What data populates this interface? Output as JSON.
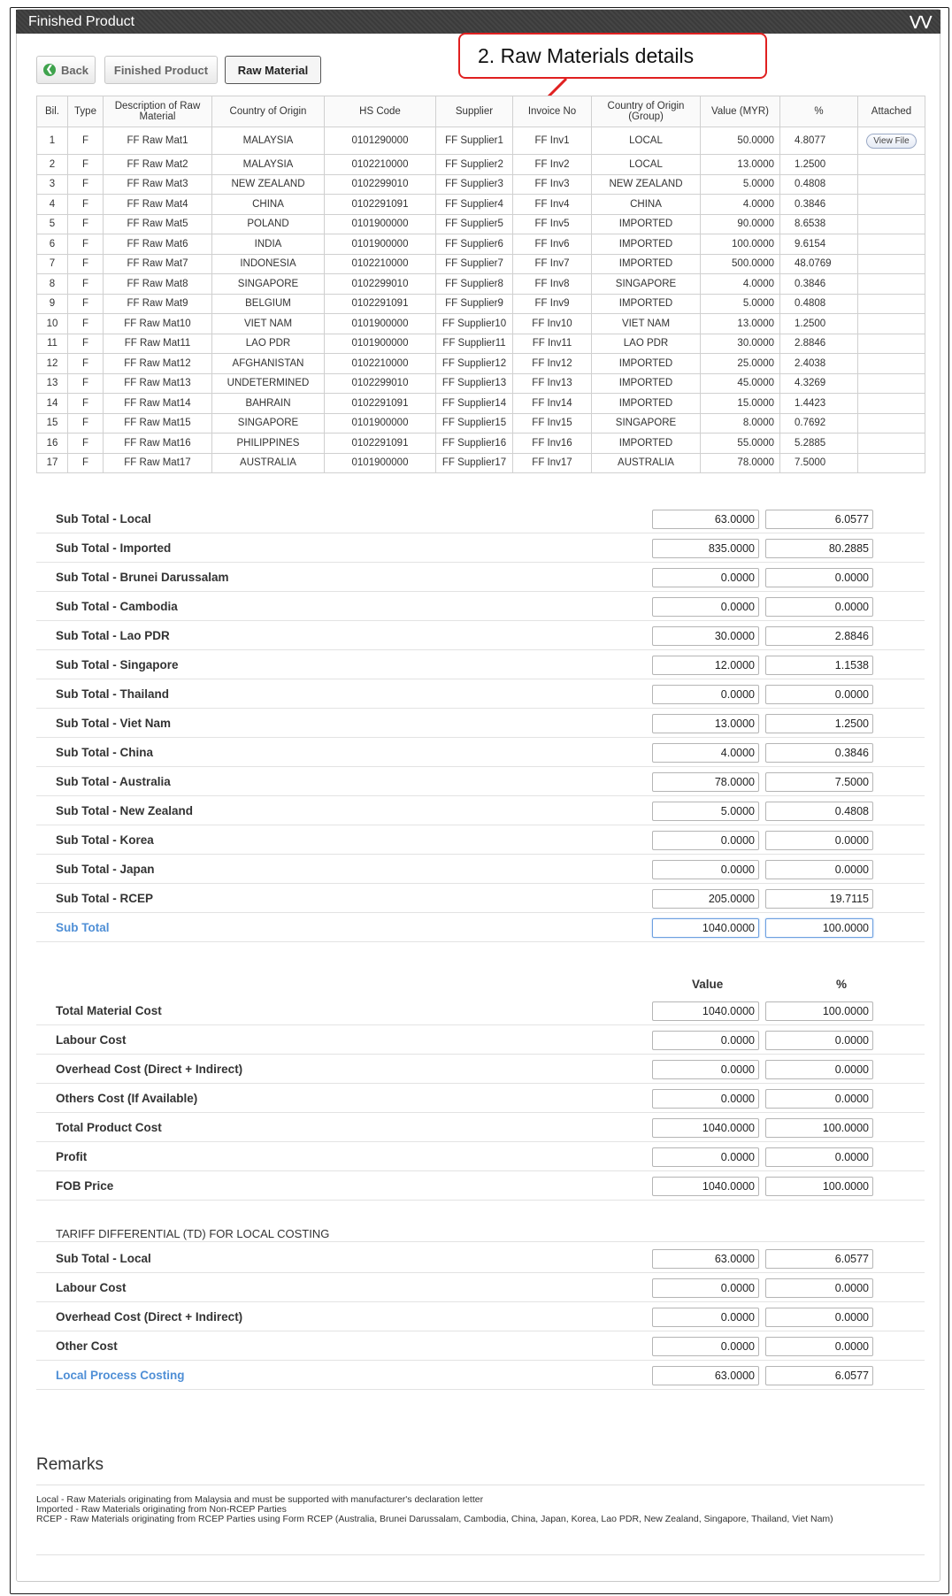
{
  "panel": {
    "title": "Finished Product"
  },
  "buttons": {
    "back": "Back",
    "finished_product": "Finished Product",
    "raw_material": "Raw Material"
  },
  "callout": {
    "text": "2. Raw Materials details"
  },
  "table": {
    "headers": [
      "Bil.",
      "Type",
      "Description of Raw Material",
      "Country of Origin",
      "HS Code",
      "Supplier",
      "Invoice No",
      "Country of Origin (Group)",
      "Value (MYR)",
      "%",
      "Attached"
    ],
    "view_file_label": "View File",
    "rows": [
      [
        "1",
        "F",
        "FF Raw Mat1",
        "MALAYSIA",
        "0101290000",
        "FF Supplier1",
        "FF Inv1",
        "LOCAL",
        "50.0000",
        "4.8077"
      ],
      [
        "2",
        "F",
        "FF Raw Mat2",
        "MALAYSIA",
        "0102210000",
        "FF Supplier2",
        "FF Inv2",
        "LOCAL",
        "13.0000",
        "1.2500"
      ],
      [
        "3",
        "F",
        "FF Raw Mat3",
        "NEW ZEALAND",
        "0102299010",
        "FF Supplier3",
        "FF Inv3",
        "NEW ZEALAND",
        "5.0000",
        "0.4808"
      ],
      [
        "4",
        "F",
        "FF Raw Mat4",
        "CHINA",
        "0102291091",
        "FF Supplier4",
        "FF Inv4",
        "CHINA",
        "4.0000",
        "0.3846"
      ],
      [
        "5",
        "F",
        "FF Raw Mat5",
        "POLAND",
        "0101900000",
        "FF Supplier5",
        "FF Inv5",
        "IMPORTED",
        "90.0000",
        "8.6538"
      ],
      [
        "6",
        "F",
        "FF Raw Mat6",
        "INDIA",
        "0101900000",
        "FF Supplier6",
        "FF Inv6",
        "IMPORTED",
        "100.0000",
        "9.6154"
      ],
      [
        "7",
        "F",
        "FF Raw Mat7",
        "INDONESIA",
        "0102210000",
        "FF Supplier7",
        "FF Inv7",
        "IMPORTED",
        "500.0000",
        "48.0769"
      ],
      [
        "8",
        "F",
        "FF Raw Mat8",
        "SINGAPORE",
        "0102299010",
        "FF Supplier8",
        "FF Inv8",
        "SINGAPORE",
        "4.0000",
        "0.3846"
      ],
      [
        "9",
        "F",
        "FF Raw Mat9",
        "BELGIUM",
        "0102291091",
        "FF Supplier9",
        "FF Inv9",
        "IMPORTED",
        "5.0000",
        "0.4808"
      ],
      [
        "10",
        "F",
        "FF Raw Mat10",
        "VIET NAM",
        "0101900000",
        "FF Supplier10",
        "FF Inv10",
        "VIET NAM",
        "13.0000",
        "1.2500"
      ],
      [
        "11",
        "F",
        "FF Raw Mat11",
        "LAO PDR",
        "0101900000",
        "FF Supplier11",
        "FF Inv11",
        "LAO PDR",
        "30.0000",
        "2.8846"
      ],
      [
        "12",
        "F",
        "FF Raw Mat12",
        "AFGHANISTAN",
        "0102210000",
        "FF Supplier12",
        "FF Inv12",
        "IMPORTED",
        "25.0000",
        "2.4038"
      ],
      [
        "13",
        "F",
        "FF Raw Mat13",
        "UNDETERMINED",
        "0102299010",
        "FF Supplier13",
        "FF Inv13",
        "IMPORTED",
        "45.0000",
        "4.3269"
      ],
      [
        "14",
        "F",
        "FF Raw Mat14",
        "BAHRAIN",
        "0102291091",
        "FF Supplier14",
        "FF Inv14",
        "IMPORTED",
        "15.0000",
        "1.4423"
      ],
      [
        "15",
        "F",
        "FF Raw Mat15",
        "SINGAPORE",
        "0101900000",
        "FF Supplier15",
        "FF Inv15",
        "SINGAPORE",
        "8.0000",
        "0.7692"
      ],
      [
        "16",
        "F",
        "FF Raw Mat16",
        "PHILIPPINES",
        "0102291091",
        "FF Supplier16",
        "FF Inv16",
        "IMPORTED",
        "55.0000",
        "5.2885"
      ],
      [
        "17",
        "F",
        "FF Raw Mat17",
        "AUSTRALIA",
        "0101900000",
        "FF Supplier17",
        "FF Inv17",
        "AUSTRALIA",
        "78.0000",
        "7.5000"
      ]
    ]
  },
  "subtotals": [
    {
      "label": "Sub Total - Local",
      "value": "63.0000",
      "pct": "6.0577"
    },
    {
      "label": "Sub Total - Imported",
      "value": "835.0000",
      "pct": "80.2885"
    },
    {
      "label": "Sub Total - Brunei Darussalam",
      "value": "0.0000",
      "pct": "0.0000"
    },
    {
      "label": "Sub Total - Cambodia",
      "value": "0.0000",
      "pct": "0.0000"
    },
    {
      "label": "Sub Total - Lao PDR",
      "value": "30.0000",
      "pct": "2.8846"
    },
    {
      "label": "Sub Total - Singapore",
      "value": "12.0000",
      "pct": "1.1538"
    },
    {
      "label": "Sub Total - Thailand",
      "value": "0.0000",
      "pct": "0.0000"
    },
    {
      "label": "Sub Total - Viet Nam",
      "value": "13.0000",
      "pct": "1.2500"
    },
    {
      "label": "Sub Total - China",
      "value": "4.0000",
      "pct": "0.3846"
    },
    {
      "label": "Sub Total - Australia",
      "value": "78.0000",
      "pct": "7.5000"
    },
    {
      "label": "Sub Total - New Zealand",
      "value": "5.0000",
      "pct": "0.4808"
    },
    {
      "label": "Sub Total - Korea",
      "value": "0.0000",
      "pct": "0.0000"
    },
    {
      "label": "Sub Total - Japan",
      "value": "0.0000",
      "pct": "0.0000"
    },
    {
      "label": "Sub Total - RCEP",
      "value": "205.0000",
      "pct": "19.7115"
    },
    {
      "label": "Sub Total",
      "value": "1040.0000",
      "pct": "100.0000",
      "highlight": true
    }
  ],
  "cost_headers": {
    "value": "Value",
    "pct": "%"
  },
  "costs": [
    {
      "label": "Total Material Cost",
      "value": "1040.0000",
      "pct": "100.0000"
    },
    {
      "label": "Labour Cost",
      "value": "0.0000",
      "pct": "0.0000"
    },
    {
      "label": "Overhead Cost (Direct + Indirect)",
      "value": "0.0000",
      "pct": "0.0000"
    },
    {
      "label": "Others Cost (If Available)",
      "value": "0.0000",
      "pct": "0.0000"
    },
    {
      "label": "Total Product Cost",
      "value": "1040.0000",
      "pct": "100.0000"
    },
    {
      "label": "Profit",
      "value": "0.0000",
      "pct": "0.0000"
    },
    {
      "label": "FOB Price",
      "value": "1040.0000",
      "pct": "100.0000"
    }
  ],
  "td": {
    "title": "TARIFF DIFFERENTIAL (TD) FOR LOCAL COSTING",
    "rows": [
      {
        "label": "Sub Total - Local",
        "value": "63.0000",
        "pct": "6.0577"
      },
      {
        "label": "Labour Cost",
        "value": "0.0000",
        "pct": "0.0000"
      },
      {
        "label": "Overhead Cost (Direct + Indirect)",
        "value": "0.0000",
        "pct": "0.0000"
      },
      {
        "label": "Other Cost",
        "value": "0.0000",
        "pct": "0.0000"
      },
      {
        "label": "Local Process Costing",
        "value": "63.0000",
        "pct": "6.0577",
        "link": true
      }
    ]
  },
  "remarks": {
    "title": "Remarks",
    "lines": [
      "Local - Raw Materials originating from Malaysia and must be supported with manufacturer's declaration letter",
      "Imported - Raw Materials originating from Non-RCEP Parties",
      "RCEP - Raw Materials originating from RCEP Parties using Form RCEP (Australia, Brunei Darussalam, Cambodia, China, Japan, Korea, Lao PDR, New Zealand, Singapore, Thailand, Viet Nam)"
    ]
  },
  "colors": {
    "accent_link": "#4f8fd6",
    "callout_border": "#e02020",
    "header_bg": "#3b3b3b",
    "back_icon": "#3fa34d"
  }
}
